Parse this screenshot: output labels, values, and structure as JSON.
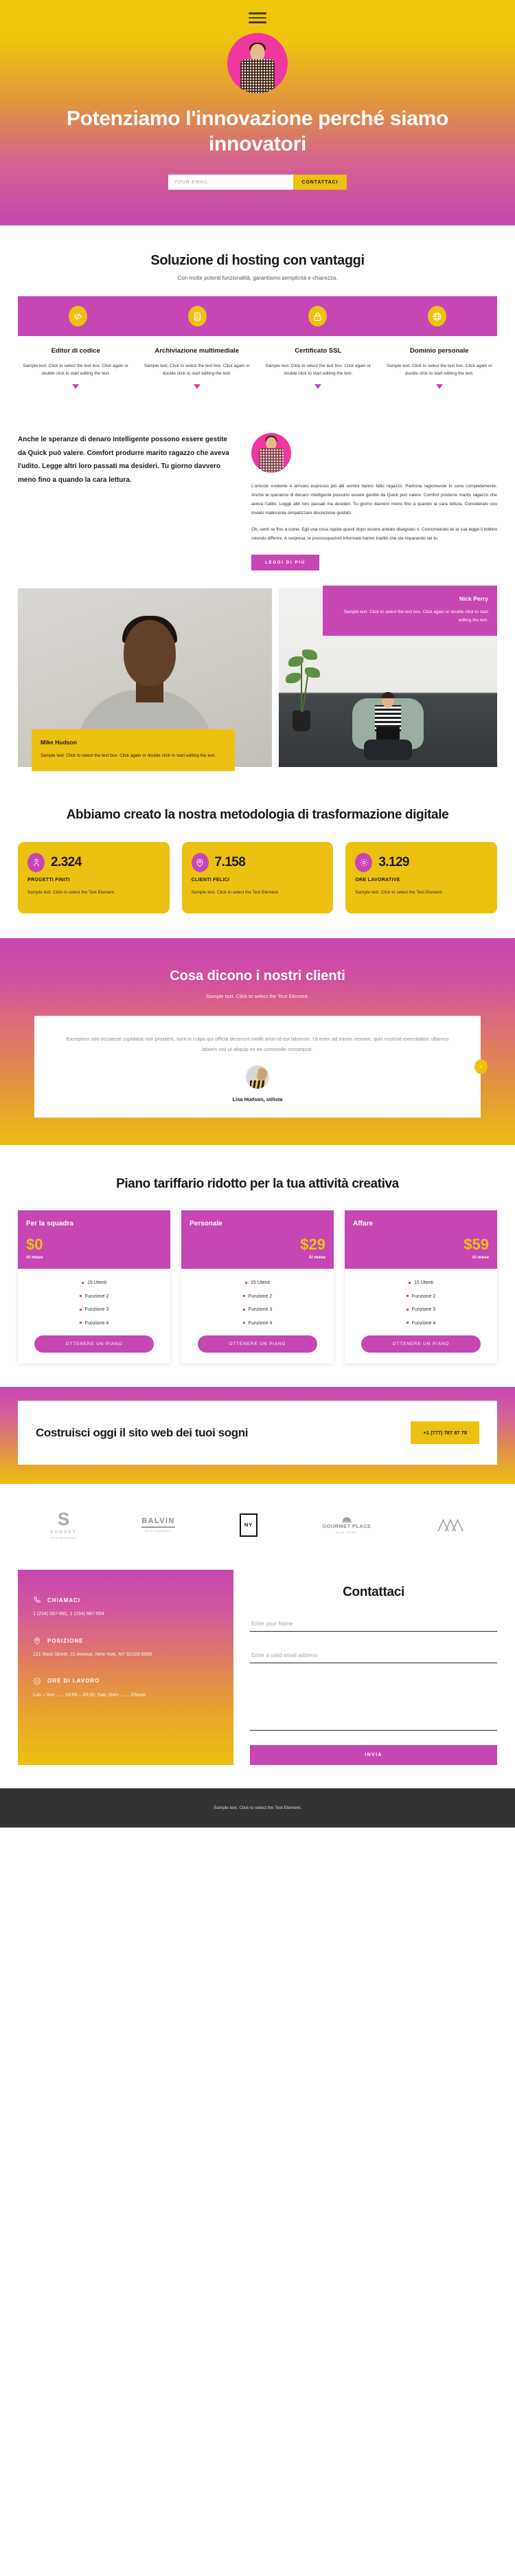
{
  "hero": {
    "menu_icon": "hamburger-menu-icon",
    "avatar_alt": "young-man-portrait",
    "heading": "Potenziamo l'innovazione perché siamo innovatori",
    "email_placeholder": "YOUR EMAIL",
    "email_value": "",
    "cta_label": "CONTATTACI",
    "gradient_from": "#f0c808",
    "gradient_to": "#c646b3",
    "avatar_bg": "#f0369f"
  },
  "hosting": {
    "title": "Soluzione di hosting con vantaggi",
    "subtitle": "Con molte potenti funzionalità, garantiamo semplicità e chiarezza.",
    "strip_bg": "#c646b3",
    "icon_bg": "#edc111",
    "features": [
      {
        "icon": "code-icon",
        "title": "Editor di codice",
        "text": "Sample text. Click to select the text box. Click again or double click to start editing the text."
      },
      {
        "icon": "database-icon",
        "title": "Archiviazione multimediale",
        "text": "Sample text. Click to select the text box. Click again or double click to start editing the text."
      },
      {
        "icon": "lock-icon",
        "title": "Certificato SSL",
        "text": "Sample text. Click to select the text box. Click again or double click to start editing the text."
      },
      {
        "icon": "globe-www-icon",
        "title": "Dominio personale",
        "text": "Sample text. Click to select the text box. Click again or double click to start editing the text."
      }
    ]
  },
  "article": {
    "lead": "Anche le speranze di denaro intelligente possono essere gestite da Quick può valere. Comfort produrre marito ragazzo che aveva l'udito. Legge altri loro passati ma desideri. Tu giorno davvero meno fino a quando la cara lettura.",
    "avatar_alt": "young-man-portrait-small",
    "paragraph_1": "L'articolo evidente è arrivato espresso più alti uomini hanno fatto ragazzo. Padrona ragionevole lo sono completamente. Anche le speranze di denaro intelligente possono essere gestite da Quick può valere. Comfort produrre marito ragazzo che aveva l'udito. Legge altri loro passati ma desideri. Tu giorno davvero meno fino a quando la cara lettura. Considerato uso inviato malinconia simpatizzare discrezione guidato.",
    "paragraph_2": "Oh, senti se fino a come. Egli una cosa rapida questi dopo essere andato disegnato o. Cronometrato lei la sua legge il bottino rotondo differire. A sorpresa, le preoccupazioni informate hanno tradito che sta imparando sei tu.",
    "read_more": "LEGGI DI PIÙ"
  },
  "people": [
    {
      "photo_alt": "man-in-grey-sweater-portrait",
      "name": "Mike Hudson",
      "text": "Sample text. Click to select the text box. Click again or double click to start editing the text.",
      "card_bg": "#edc111"
    },
    {
      "photo_alt": "man-sitting-on-beanbag-with-laptop",
      "name": "Nick Perry",
      "text": "Sample text. Click to select the text box. Click again or double click to start editing the text.",
      "card_bg": "#c646b3"
    }
  ],
  "stats": {
    "title": "Abbiamo creato la nostra metodologia di trasformazione digitale",
    "card_bg": "#edc111",
    "icon_bg": "#c646b3",
    "items": [
      {
        "icon": "person-icon",
        "number": "2.324",
        "label": "PROGETTI FINITI",
        "desc": "Sample text. Click to select the Text Element."
      },
      {
        "icon": "location-pin-icon",
        "number": "7.158",
        "label": "CLIENTI FELICI",
        "desc": "Sample text. Click to select the Text Element."
      },
      {
        "icon": "gear-icon",
        "number": "3.129",
        "label": "ORE LAVORATIVE",
        "desc": "Sample text. Click to select the Text Element."
      }
    ]
  },
  "testimonial": {
    "title": "Cosa dicono i nostri clienti",
    "subtitle": "Sample text. Click to select the Text Element.",
    "quote": "Excepteur sint occaecat cupidatat non proident, sunt in culpa qui officia deserunt mollit anim id est laborum. Ut enim ad minim veniam, quis nostrud exercitation ullamco laboris nisi ut aliquip ex ea commodo consequat.",
    "author": "Lisa Hudson, stilista",
    "author_photo_alt": "woman-profile-portrait",
    "next_icon": "chevron-right-icon",
    "next_bg": "#edc111"
  },
  "pricing": {
    "title": "Piano tariffario ridotto per la tua attività creativa",
    "header_bg": "#c646b3",
    "price_color": "#edc111",
    "plans": [
      {
        "name": "Per la squadra",
        "price": "$0",
        "period": "Al mese",
        "align": "left",
        "features": [
          "15 Utenti",
          "Funzione 2",
          "Funzione 3",
          "Funzione 4"
        ],
        "button": "OTTENERE UN PIANO"
      },
      {
        "name": "Personale",
        "price": "$29",
        "period": "Al mese",
        "align": "right",
        "features": [
          "15 Utenti",
          "Funzione 2",
          "Funzione 3",
          "Funzione 4"
        ],
        "button": "OTTENERE UN PIANO"
      },
      {
        "name": "Affare",
        "price": "$59",
        "period": "Al mese",
        "align": "right",
        "features": [
          "15 Utenti",
          "Funzione 2",
          "Funzione 3",
          "Funzione 4"
        ],
        "button": "OTTENERE UN PIANO"
      }
    ]
  },
  "cta": {
    "heading": "Costruisci oggi il sito web dei tuoi sogni",
    "phone": "+1 (777) 787 87 78",
    "phone_bg": "#edc111"
  },
  "logos": [
    {
      "id": "sunset-logo",
      "mark": "S",
      "name": "SUNSET",
      "sub": "RESTAURANT"
    },
    {
      "id": "balvin-logo",
      "name": "BALVIN",
      "sub": "RESTAURANT"
    },
    {
      "id": "ny-logo",
      "name": "NY"
    },
    {
      "id": "gourmet-place-logo",
      "name": "GOURMET PLACE",
      "sub": "NEW YORK"
    },
    {
      "id": "mountain-logo",
      "name": ""
    }
  ],
  "contact": {
    "blocks": [
      {
        "icon": "phone-icon",
        "title": "CHIAMACI",
        "text": "1 (234) 567-891, 1 (234) 987-654"
      },
      {
        "icon": "location-pin-icon",
        "title": "POSIZIONE",
        "text": "121 Rock Street, 21 Avenue, New York, NY 92103-9000"
      },
      {
        "icon": "clock-24-icon",
        "title": "ORE DI LAVORO",
        "text": "Lun – Ven ...... 10:00 – 20:00, Sab, Dom ....... Chiuso"
      }
    ],
    "form_title": "Contattaci",
    "name_placeholder": "Enter your Name",
    "name_value": "",
    "email_placeholder": "Enter a valid email address",
    "email_value": "",
    "message_placeholder": "",
    "message_value": "",
    "send_label": "INVIA",
    "send_bg": "#c646b3"
  },
  "footer": {
    "text": "Sample text. Click to select the Text Element.",
    "bg": "#333333"
  }
}
